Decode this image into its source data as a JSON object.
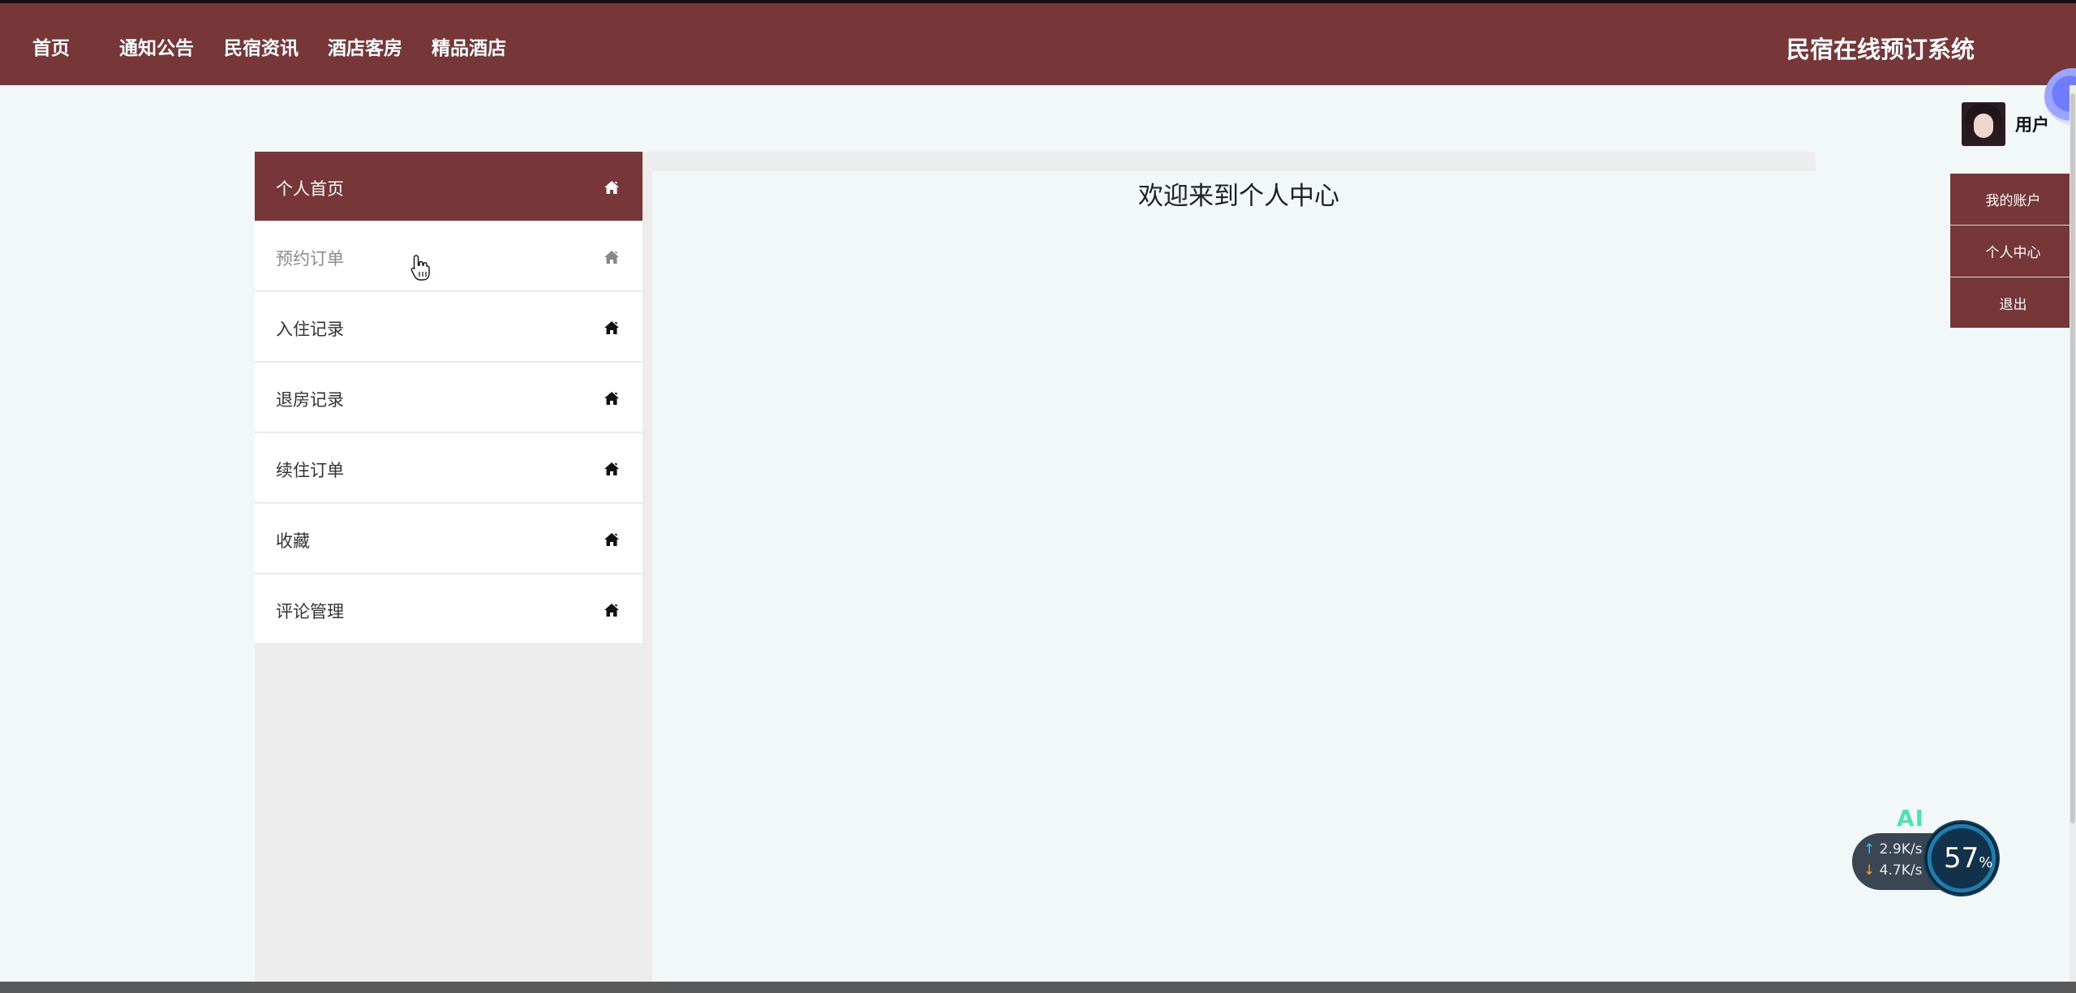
{
  "header": {
    "nav": [
      "首页",
      "通知公告",
      "民宿资讯",
      "酒店客房",
      "精品酒店"
    ],
    "site_title": "民宿在线预订系统",
    "bg_color": "#773739"
  },
  "user": {
    "name": "用户",
    "menu": [
      "我的账户",
      "个人中心",
      "退出"
    ]
  },
  "sidebar": {
    "items": [
      {
        "label": "个人首页",
        "icon": "home-icon",
        "state": "active"
      },
      {
        "label": "预约订单",
        "icon": "home-icon",
        "state": "hover"
      },
      {
        "label": "入住记录",
        "icon": "home-icon",
        "state": "normal"
      },
      {
        "label": "退房记录",
        "icon": "home-icon",
        "state": "normal"
      },
      {
        "label": "续住订单",
        "icon": "home-icon",
        "state": "normal"
      },
      {
        "label": "收藏",
        "icon": "home-icon",
        "state": "normal"
      },
      {
        "label": "评论管理",
        "icon": "home-icon",
        "state": "normal"
      }
    ]
  },
  "main": {
    "welcome": "欢迎来到个人中心"
  },
  "net_widget": {
    "label": "AI",
    "upload": "2.9",
    "download": "4.7",
    "unit": "K/s",
    "percent": "57",
    "percent_unit": "%"
  }
}
